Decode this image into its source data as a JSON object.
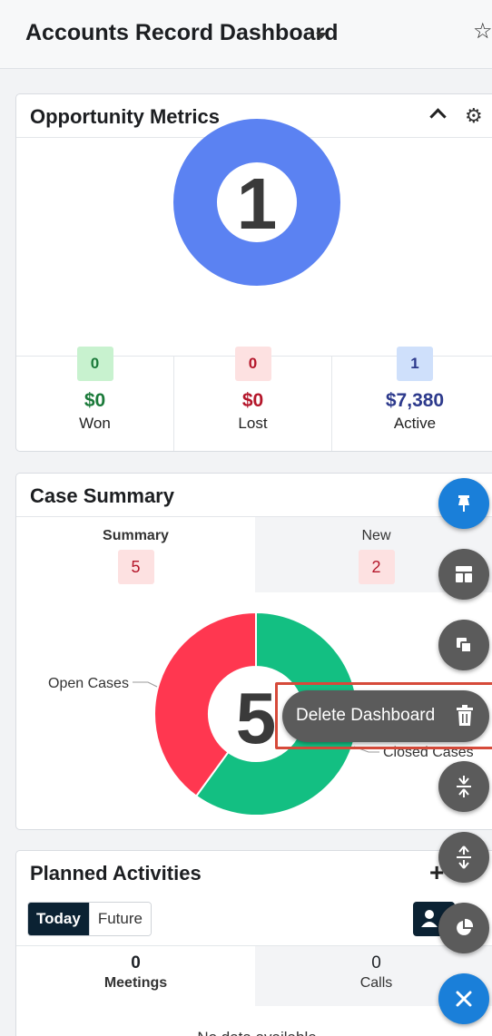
{
  "header": {
    "title": "Accounts Record Dashboard",
    "star_icon": "star-icon"
  },
  "opportunity_metrics": {
    "title": "Opportunity Metrics",
    "total": "1",
    "metrics": [
      {
        "count": "0",
        "amount": "$0",
        "label": "Won",
        "color": "#1b7a3a",
        "badge_bg": "#c8f2cf"
      },
      {
        "count": "0",
        "amount": "$0",
        "label": "Lost",
        "color": "#b4162a",
        "badge_bg": "#fde1e1"
      },
      {
        "count": "1",
        "amount": "$7,380",
        "label": "Active",
        "color": "#2d3a8c",
        "badge_bg": "#cfe0fb"
      }
    ],
    "donut_color": "#5b82f2"
  },
  "case_summary": {
    "title": "Case Summary",
    "tabs": [
      {
        "label": "Summary",
        "count": "5"
      },
      {
        "label": "New",
        "count": "2"
      }
    ],
    "total": "5",
    "slices": [
      {
        "label": "Open Cases",
        "value": 2,
        "color": "#ff3750"
      },
      {
        "label": "Closed Cases",
        "value": 3,
        "color": "#13bf82"
      }
    ]
  },
  "planned_activities": {
    "title": "Planned Activities",
    "toggle": [
      "Today",
      "Future"
    ],
    "columns": [
      {
        "count": "0",
        "label": "Meetings"
      },
      {
        "count": "0",
        "label": "Calls"
      }
    ],
    "empty_text": "No data available"
  },
  "fab_menu": {
    "tooltip": "Delete Dashboard",
    "buttons": [
      "pin-icon",
      "layout-icon",
      "duplicate-icon",
      "delete-icon",
      "collapse-icon",
      "expand-icon",
      "pie-chart-icon",
      "close-icon"
    ]
  }
}
